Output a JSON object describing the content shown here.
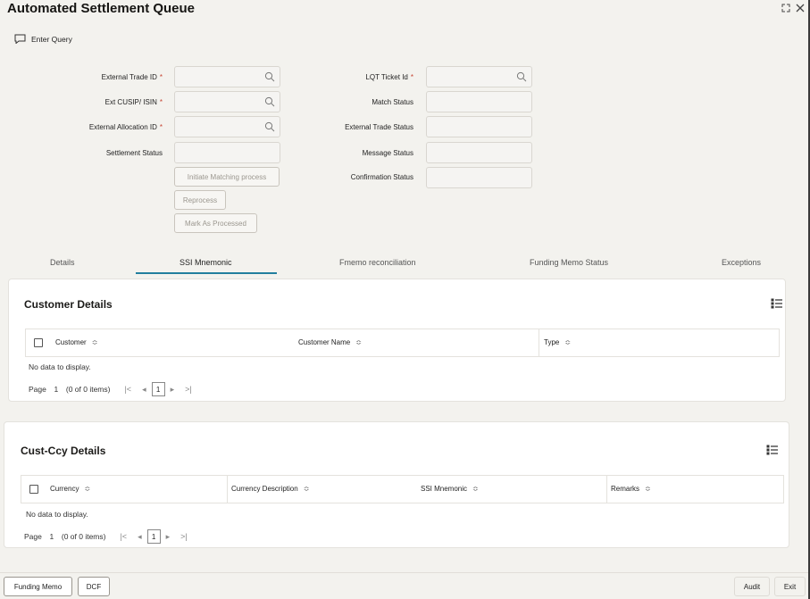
{
  "header": {
    "title": "Automated Settlement Queue",
    "enter_query_label": "Enter Query"
  },
  "form": {
    "left": [
      {
        "label": "External Trade ID",
        "required": "*",
        "value": ""
      },
      {
        "label": "Ext CUSIP/ ISIN",
        "required": "*",
        "value": ""
      },
      {
        "label": "External Allocation ID",
        "required": "*",
        "value": ""
      },
      {
        "label": "Settlement Status",
        "required": "",
        "value": ""
      }
    ],
    "right": [
      {
        "label": "LQT Ticket Id",
        "required": "*",
        "value": ""
      },
      {
        "label": "Match Status",
        "required": "",
        "value": ""
      },
      {
        "label": "External Trade Status",
        "required": "",
        "value": ""
      },
      {
        "label": "Message Status",
        "required": "",
        "value": ""
      },
      {
        "label": "Confirmation Status",
        "required": "",
        "value": ""
      }
    ],
    "buttons": {
      "initiate": "Initiate Matching process",
      "reprocess": "Reprocess",
      "mark_processed": "Mark As Processed"
    }
  },
  "tabs": [
    {
      "label": "Details"
    },
    {
      "label": "SSI Mnemonic"
    },
    {
      "label": "Fmemo reconciliation"
    },
    {
      "label": "Funding Memo Status"
    },
    {
      "label": "Exceptions"
    }
  ],
  "customer_details": {
    "title": "Customer Details",
    "columns": [
      "Customer",
      "Customer Name",
      "Type"
    ],
    "sort_glyph": "≎",
    "no_data": "No data to display.",
    "pager": {
      "page_label": "Page",
      "page_value": "1",
      "items": "(0 of 0 items)",
      "first": "|<",
      "prev": "◂",
      "current": "1",
      "next": "▸",
      "last": ">|"
    }
  },
  "cust_ccy_details": {
    "title": "Cust-Ccy Details",
    "columns": [
      "Currency",
      "Currency Description",
      "SSI Mnemonic",
      "Remarks"
    ],
    "sort_glyph": "≎",
    "no_data": "No data to display.",
    "pager": {
      "page_label": "Page",
      "page_value": "1",
      "items": "(0 of 0 items)",
      "first": "|<",
      "prev": "◂",
      "current": "1",
      "next": "▸",
      "last": ">|"
    }
  },
  "footer": {
    "funding_memo": "Funding Memo",
    "dcf": "DCF",
    "audit": "Audit",
    "exit": "Exit"
  },
  "colors": {
    "accent": "#227e9e",
    "required": "#c74634",
    "background": "#f3f2ee"
  }
}
